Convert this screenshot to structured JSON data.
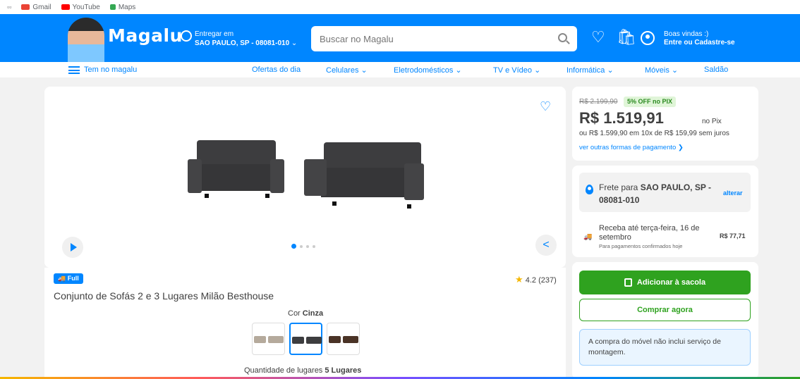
{
  "bookmarks": [
    {
      "label": "Gmail",
      "color": "#ea4335"
    },
    {
      "label": "YouTube",
      "color": "#ff0000"
    },
    {
      "label": "Maps",
      "color": "#34a853"
    }
  ],
  "header": {
    "logo": "Magalu",
    "deliver_title": "Entregar em",
    "deliver_location": "SAO PAULO, SP - 08081-010",
    "search_placeholder": "Buscar no Magalu",
    "welcome_line1": "Boas vindas :)",
    "welcome_line2": "Entre ou Cadastre-se",
    "brand_color": "#0086ff"
  },
  "nav": {
    "menu_label": "Tem no magalu",
    "items": [
      "Ofertas do dia",
      "Celulares ⌄",
      "Eletrodomésticos ⌄",
      "TV e Vídeo ⌄",
      "Informática ⌄",
      "Móveis ⌄",
      "Saldão"
    ]
  },
  "product": {
    "badge": "Full",
    "title": "Conjunto de Sofás 2 e 3 Lugares Milão Besthouse",
    "rating": "4.2 (237)",
    "color_label": "Cor",
    "color_value": "Cinza",
    "quantity_label": "Quantidade de lugares",
    "quantity_value": "5 Lugares",
    "gallery_dots": 4,
    "gallery_active": 0
  },
  "pricing": {
    "old_price": "R$ 2.199,90",
    "discount_badge": "5% OFF no PIX",
    "price": "R$ 1.519,91",
    "price_suffix": "no Pix",
    "installments": "ou R$ 1.599,90 em 10x de R$ 159,99 sem juros",
    "other_payments": "ver outras formas de pagamento ❯"
  },
  "shipping": {
    "frete_prefix": "Frete para",
    "frete_location": "SAO PAULO, SP - 08081-010",
    "alterar": "alterar",
    "receba": "Receba até terça-feira, 16 de setembro",
    "receba_sub": "Para pagamentos confirmados hoje",
    "price": "R$ 77,71"
  },
  "actions": {
    "add_to_bag": "Adicionar à sacola",
    "buy_now": "Comprar agora",
    "notice": "A compra do móvel não inclui serviço de montagem."
  }
}
